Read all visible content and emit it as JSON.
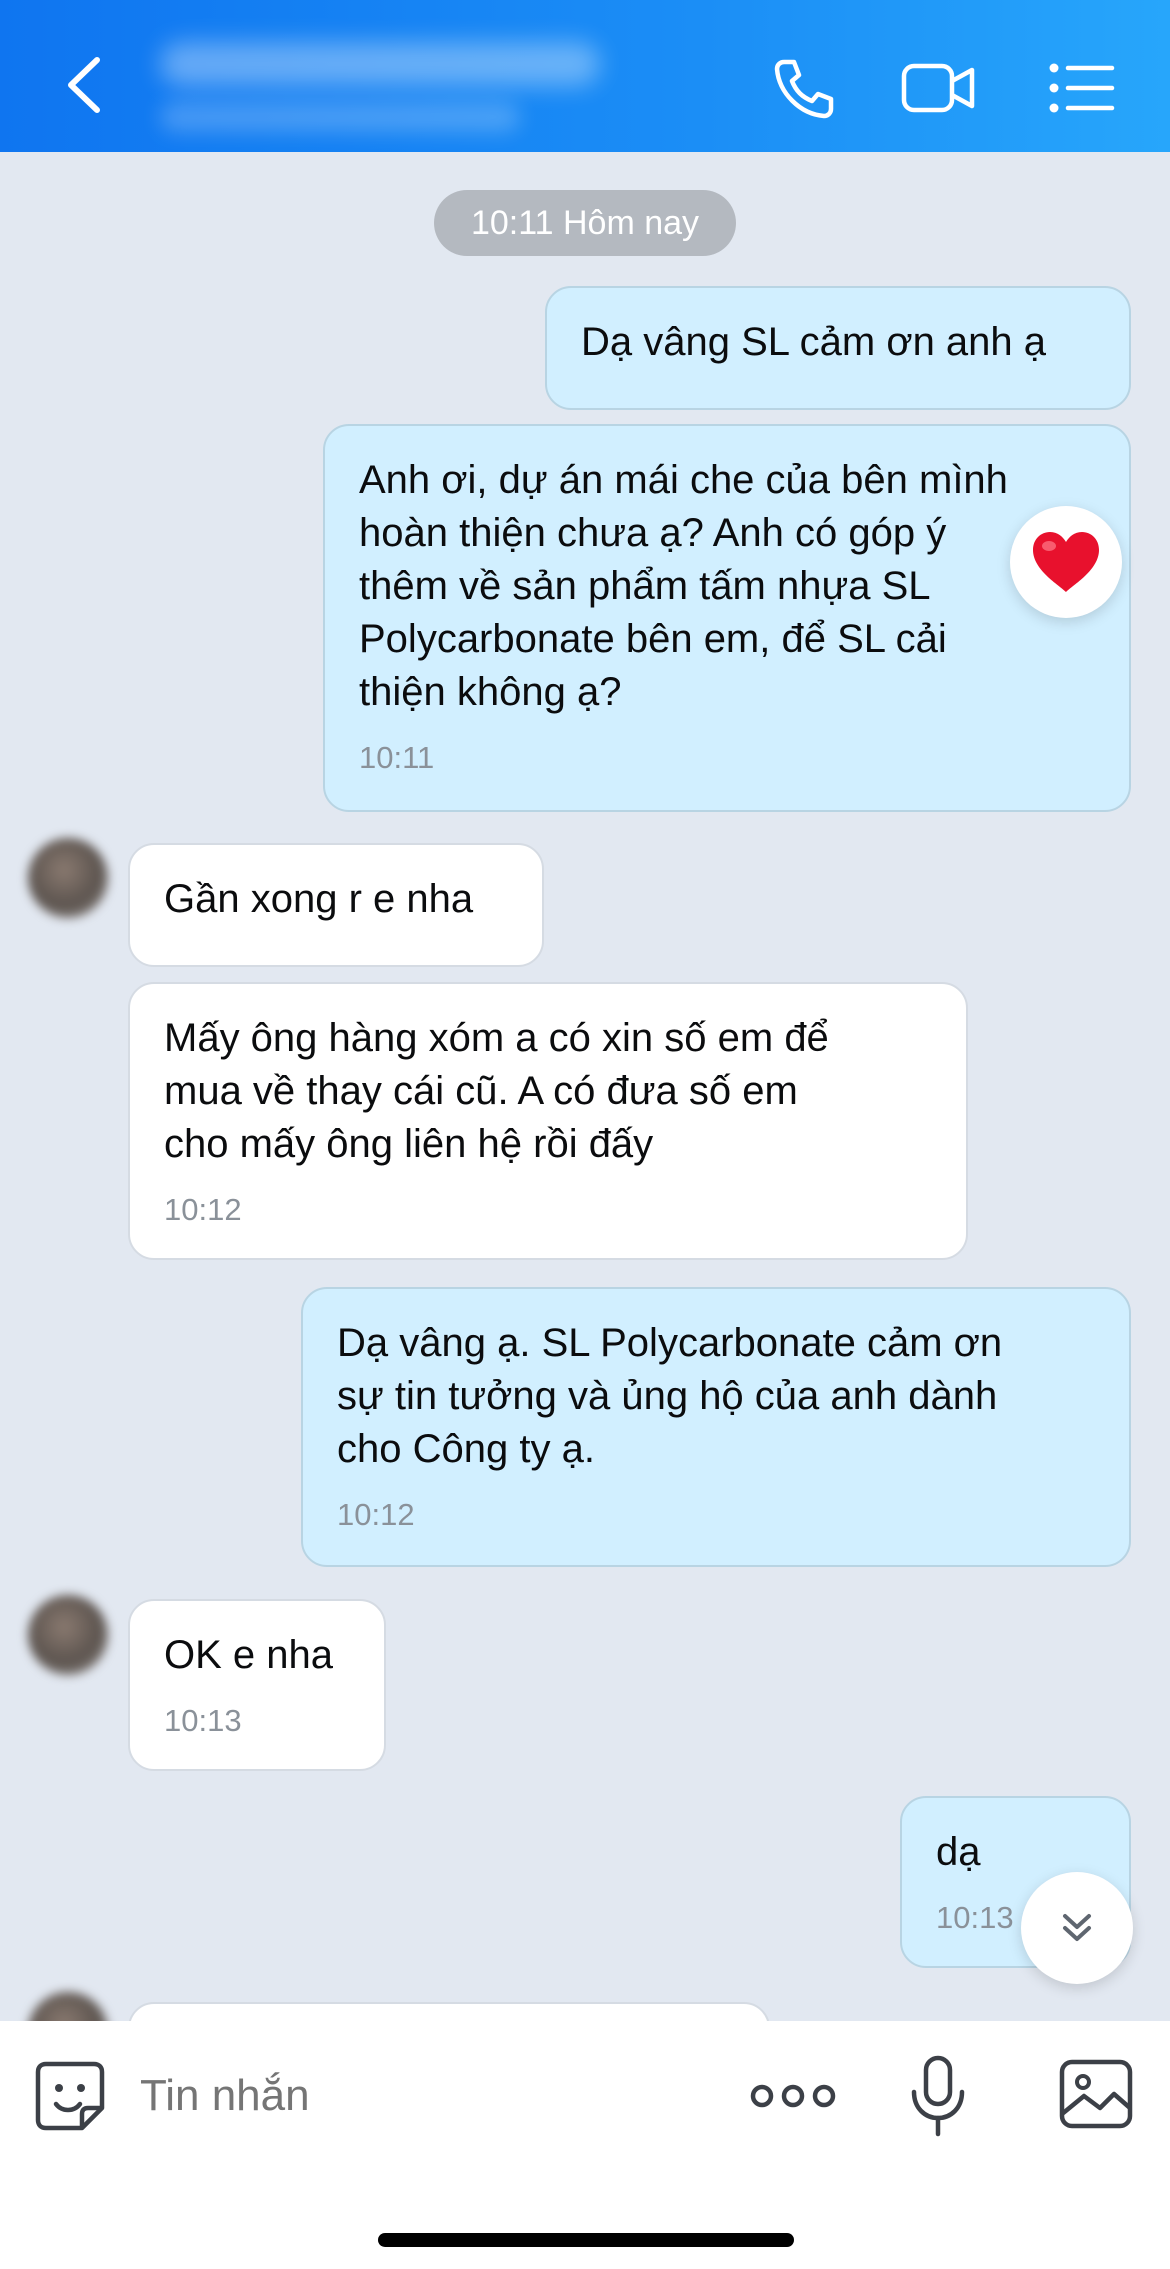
{
  "header": {
    "back_icon": "chevron-left-icon",
    "call_icon": "phone-icon",
    "video_icon": "video-camera-icon",
    "menu_icon": "list-menu-icon",
    "background": "#1583f2"
  },
  "timestamp_pill": "10:11 Hôm nay",
  "messages": [
    {
      "side": "out",
      "lines": [
        "Dạ vâng SL cảm ơn anh ạ"
      ],
      "time": ""
    },
    {
      "side": "out",
      "lines": [
        "Anh ơi, dự án mái che của bên mình",
        "hoàn thiện chưa ạ? Anh có góp ý",
        "thêm về sản phẩm tấm nhựa SL",
        "Polycarbonate bên em, để SL cải",
        "thiện không ạ?"
      ],
      "time": "10:11",
      "reaction": "heart-icon"
    },
    {
      "side": "in",
      "lines": [
        "Gần xong r e nha"
      ],
      "time": ""
    },
    {
      "side": "in",
      "lines": [
        "Mấy ông hàng xóm a có xin số em để",
        "mua về thay cái cũ. A có đưa số em",
        "cho mấy ông liên hệ rồi đấy"
      ],
      "time": "10:12"
    },
    {
      "side": "out",
      "lines": [
        "Dạ vâng ạ. SL Polycarbonate cảm ơn",
        "sự tin tưởng và ủng hộ của anh dành",
        "cho Công ty ạ."
      ],
      "time": "10:12"
    },
    {
      "side": "in",
      "lines": [
        "OK e nha"
      ],
      "time": "10:13"
    },
    {
      "side": "out",
      "lines": [
        "dạ"
      ],
      "time": "10:13"
    }
  ],
  "input": {
    "placeholder": "Tin nhắn",
    "sticker_icon": "sticker-icon",
    "more_icon": "more-dots-icon",
    "mic_icon": "microphone-icon",
    "image_icon": "image-icon"
  },
  "colors": {
    "chat_background": "#e2e8f1",
    "outgoing_bubble": "#d1efff",
    "incoming_bubble": "#ffffff",
    "accent": "#1583f2"
  }
}
